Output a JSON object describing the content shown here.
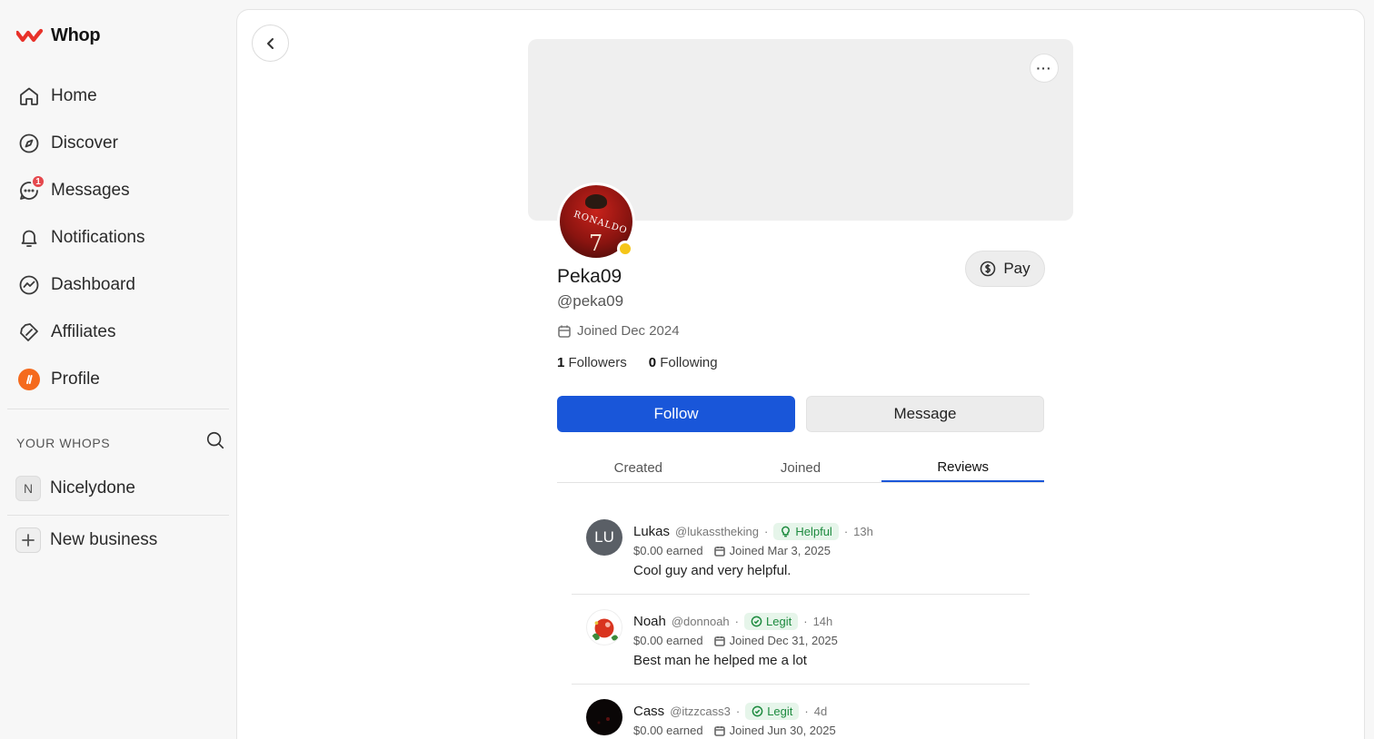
{
  "app": {
    "name": "Whop"
  },
  "sidebar": {
    "items": [
      {
        "label": "Home",
        "icon": "home-icon"
      },
      {
        "label": "Discover",
        "icon": "compass-icon"
      },
      {
        "label": "Messages",
        "icon": "chat-icon",
        "badge": "1"
      },
      {
        "label": "Notifications",
        "icon": "bell-icon"
      },
      {
        "label": "Dashboard",
        "icon": "chart-icon"
      },
      {
        "label": "Affiliates",
        "icon": "affiliate-icon"
      },
      {
        "label": "Profile",
        "icon": "profile-avatar-icon"
      }
    ],
    "your_whops_title": "YOUR WHOPS",
    "whops": [
      {
        "letter": "N",
        "name": "Nicelydone"
      }
    ],
    "new_business": "New business"
  },
  "profile": {
    "name": "Peka09",
    "handle": "@peka09",
    "joined": "Joined Dec 2024",
    "followers_count": "1",
    "followers_label": "Followers",
    "following_count": "0",
    "following_label": "Following",
    "pay_label": "Pay",
    "follow_label": "Follow",
    "message_label": "Message",
    "more_label": "···",
    "avatar_text": "RONALDO",
    "avatar_number": "7"
  },
  "tabs": [
    {
      "label": "Created"
    },
    {
      "label": "Joined"
    },
    {
      "label": "Reviews",
      "active": true
    }
  ],
  "reviews": [
    {
      "initials": "LU",
      "name": "Lukas",
      "handle": "@lukasstheking",
      "tag": "Helpful",
      "time": "13h",
      "earned": "$0.00 earned",
      "joined": "Joined Mar 3, 2025",
      "text": "Cool guy and very helpful."
    },
    {
      "initials": "",
      "name": "Noah",
      "handle": "@donnoah",
      "tag": "Legit",
      "time": "14h",
      "earned": "$0.00 earned",
      "joined": "Joined Dec 31, 2025",
      "text": "Best man he helped me a lot"
    },
    {
      "initials": "",
      "name": "Cass",
      "handle": "@itzzcass3",
      "tag": "Legit",
      "time": "4d",
      "earned": "$0.00 earned",
      "joined": "Joined Jun 30, 2025",
      "text": ""
    }
  ],
  "colors": {
    "accent": "#1956d9",
    "badge": "#e5484d",
    "status": "#f5c518",
    "tag_bg": "#e6f5ea",
    "tag_fg": "#1c8a3e",
    "brand": "#e8322a"
  }
}
